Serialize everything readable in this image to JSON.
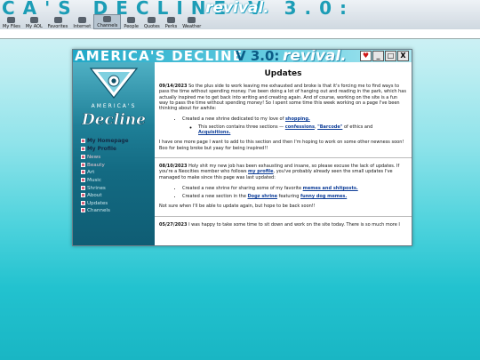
{
  "toolbar": {
    "banner_text": "CA'S DECLINE V 3.0:",
    "banner_revival": "revival.",
    "tools": [
      "My Files",
      "My AOL",
      "Favorites",
      "Internet",
      "Channels",
      "People",
      "Quotes",
      "Perks",
      "Weather"
    ]
  },
  "window": {
    "title_main": "AMERICA'S DECLINE",
    "title_version": "V 3.0:",
    "title_revival": "revival.",
    "btn_heart": "♥",
    "btn_min": "_",
    "btn_max": "□",
    "btn_close": "X"
  },
  "sidebar": {
    "logo_small": "AMERICA'S",
    "logo_script": "Decline",
    "nav": [
      {
        "label": "My Homepage"
      },
      {
        "label": "My Profile"
      },
      {
        "label": "News"
      },
      {
        "label": "Beauty"
      },
      {
        "label": "Art"
      },
      {
        "label": "Music"
      },
      {
        "label": "Shrines"
      },
      {
        "label": "About"
      },
      {
        "label": "Updates"
      },
      {
        "label": "Channels"
      }
    ]
  },
  "content": {
    "heading": "Updates",
    "post1": {
      "date": "09/14/2023",
      "body": " So the plus side to work leaving me exhausted and broke is that it's forcing me to find ways to pass the time without spending money. I've been doing a lot of hanging out and reading in the park, which has actually inspired me to get back into writing and creating again. And of course, working on the site is a fun way to pass the time without spending money! So I spent some time this week working on a page I've been thinking about for awhile:",
      "li1_text": "Created a new shrine dedicated to my love of ",
      "li1_link": "shopping.",
      "sub_text1": "This section contains three sections — ",
      "sub_link1": "confessions",
      "sub_text2": ", ",
      "sub_link2": "\"Barcode\"",
      "sub_text3": " of ethics and ",
      "sub_link3": "Acquisitions.",
      "outro": "I have one more page I want to add to this section and then I'm hoping to work on some other newness soon! Boo for being broke but yaay for being inspired!!"
    },
    "post2": {
      "date": "08/10/2023",
      "body1": " Holy shit my new job has been exhausting and insane, so please excuse the lack of updates. If you're a Neocities member who follows ",
      "link": "my profile",
      "body2": ", you've probably already seen the small updates I've managed to make since this page was last updated:",
      "li1_text": "Created a new shrine for sharing some of my favorite ",
      "li1_link": "memes and shitposts.",
      "li2_text": "Created a new section in the ",
      "li2_link": "Dogz shrine",
      "li2_text2": " featuring ",
      "li2_link2": "funny dog memes.",
      "outro": "Not sure when I'll be able to update again, but hope to be back soon!!"
    },
    "post3": {
      "date": "05/27/2023",
      "body": " I was happy to take some time to sit down and work on the site today. There is so much more I"
    }
  }
}
